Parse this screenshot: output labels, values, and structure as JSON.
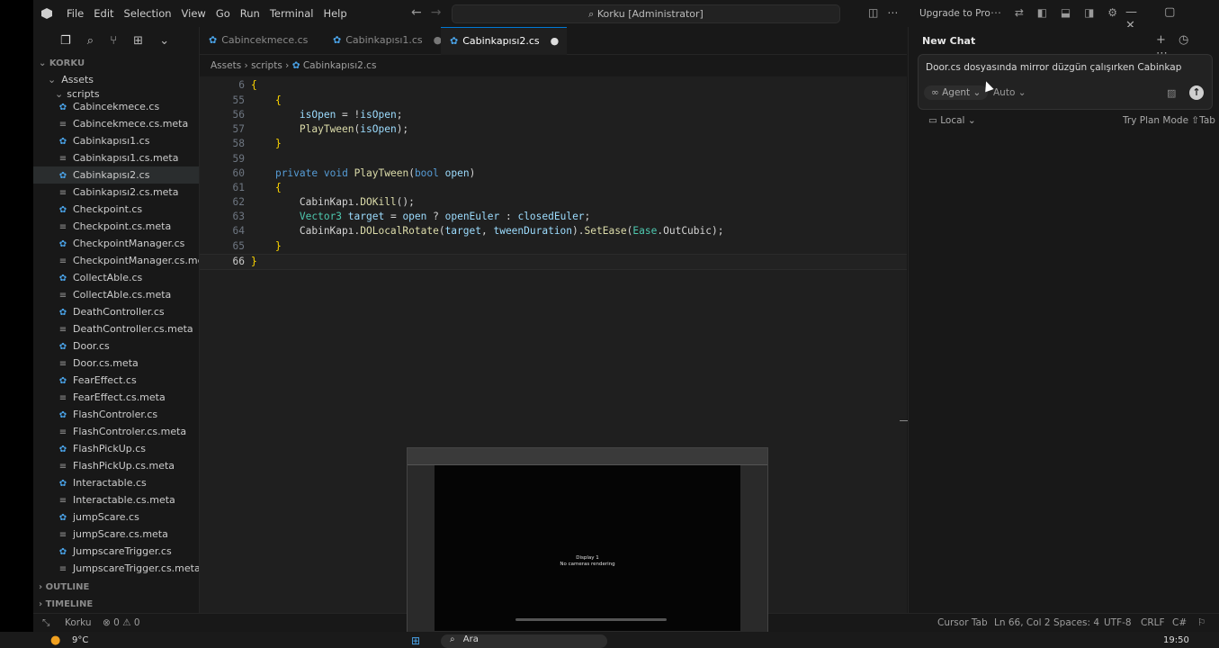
{
  "menu": [
    "File",
    "Edit",
    "Selection",
    "View",
    "Go",
    "Run",
    "Terminal",
    "Help"
  ],
  "search": {
    "text": "Korku [Administrator]"
  },
  "upgrade_label": "Upgrade to Pro",
  "sidebar": {
    "root": "KORKU",
    "assets": "Assets",
    "scripts": "scripts",
    "files": [
      {
        "name": "Cabincekmece.cs",
        "type": "cs",
        "sel": false
      },
      {
        "name": "Cabincekmece.cs.meta",
        "type": "meta",
        "sel": false
      },
      {
        "name": "Cabinkapısı1.cs",
        "type": "cs",
        "sel": false
      },
      {
        "name": "Cabinkapısı1.cs.meta",
        "type": "meta",
        "sel": false
      },
      {
        "name": "Cabinkapısı2.cs",
        "type": "cs",
        "sel": true
      },
      {
        "name": "Cabinkapısı2.cs.meta",
        "type": "meta",
        "sel": false
      },
      {
        "name": "Checkpoint.cs",
        "type": "cs",
        "sel": false
      },
      {
        "name": "Checkpoint.cs.meta",
        "type": "meta",
        "sel": false
      },
      {
        "name": "CheckpointManager.cs",
        "type": "cs",
        "sel": false
      },
      {
        "name": "CheckpointManager.cs.meta",
        "type": "meta",
        "sel": false
      },
      {
        "name": "CollectAble.cs",
        "type": "cs",
        "sel": false
      },
      {
        "name": "CollectAble.cs.meta",
        "type": "meta",
        "sel": false
      },
      {
        "name": "DeathController.cs",
        "type": "cs",
        "sel": false
      },
      {
        "name": "DeathController.cs.meta",
        "type": "meta",
        "sel": false
      },
      {
        "name": "Door.cs",
        "type": "cs",
        "sel": false
      },
      {
        "name": "Door.cs.meta",
        "type": "meta",
        "sel": false
      },
      {
        "name": "FearEffect.cs",
        "type": "cs",
        "sel": false
      },
      {
        "name": "FearEffect.cs.meta",
        "type": "meta",
        "sel": false
      },
      {
        "name": "FlashControler.cs",
        "type": "cs",
        "sel": false
      },
      {
        "name": "FlashControler.cs.meta",
        "type": "meta",
        "sel": false
      },
      {
        "name": "FlashPickUp.cs",
        "type": "cs",
        "sel": false
      },
      {
        "name": "FlashPickUp.cs.meta",
        "type": "meta",
        "sel": false
      },
      {
        "name": "Interactable.cs",
        "type": "cs",
        "sel": false
      },
      {
        "name": "Interactable.cs.meta",
        "type": "meta",
        "sel": false
      },
      {
        "name": "jumpScare.cs",
        "type": "cs",
        "sel": false
      },
      {
        "name": "jumpScare.cs.meta",
        "type": "meta",
        "sel": false
      },
      {
        "name": "JumpscareTrigger.cs",
        "type": "cs",
        "sel": false
      },
      {
        "name": "JumpscareTrigger.cs.meta",
        "type": "meta",
        "sel": false
      }
    ],
    "outline": "OUTLINE",
    "timeline": "TIMELINE"
  },
  "tabs": [
    {
      "label": "Cabincekmece.cs",
      "active": false,
      "dirty": false
    },
    {
      "label": "Cabinkapısı1.cs",
      "active": false,
      "dirty": true
    },
    {
      "label": "Cabinkapısı2.cs",
      "active": true,
      "dirty": true
    }
  ],
  "breadcrumb": {
    "a": "Assets",
    "b": "scripts",
    "c": "Cabinkapısı2.cs"
  },
  "code": [
    {
      "ln": "6",
      "text": "{",
      "cur": false
    },
    {
      "ln": "55",
      "text": "    {",
      "cur": false
    },
    {
      "ln": "56",
      "text": "        isOpen = !isOpen;",
      "cur": false
    },
    {
      "ln": "57",
      "text": "        PlayTween(isOpen);",
      "cur": false
    },
    {
      "ln": "58",
      "text": "    }",
      "cur": false
    },
    {
      "ln": "59",
      "text": "",
      "cur": false
    },
    {
      "ln": "60",
      "text": "    private void PlayTween(bool open)",
      "cur": false
    },
    {
      "ln": "61",
      "text": "    {",
      "cur": false
    },
    {
      "ln": "62",
      "text": "        CabinKapı.DOKill();",
      "cur": false
    },
    {
      "ln": "63",
      "text": "        Vector3 target = open ? openEuler : closedEuler;",
      "cur": false
    },
    {
      "ln": "64",
      "text": "        CabinKapı.DOLocalRotate(target, tweenDuration).SetEase(Ease.OutCubic);",
      "cur": false
    },
    {
      "ln": "65",
      "text": "    }",
      "cur": false
    },
    {
      "ln": "66",
      "text": "}",
      "cur": true
    }
  ],
  "chat": {
    "title": "New Chat",
    "input": "Door.cs dosyasında mirror düzgün çalışırken Cabinkap",
    "agent": "Agent",
    "auto": "Auto",
    "local": "Local",
    "plan": "Try Plan Mode ⇧Tab"
  },
  "overlay": {
    "line1": "Display 1",
    "line2": "No cameras rendering"
  },
  "status": {
    "project": "Korku",
    "problems": "⊗ 0 ⚠ 0",
    "cursor_tab": "Cursor Tab",
    "position": "Ln 66, Col 2",
    "spaces": "Spaces: 4",
    "encoding": "UTF-8",
    "eol": "CRLF",
    "lang": "C#"
  },
  "taskbar": {
    "weather": "9°C",
    "search": "Ara",
    "time": "19:50"
  }
}
